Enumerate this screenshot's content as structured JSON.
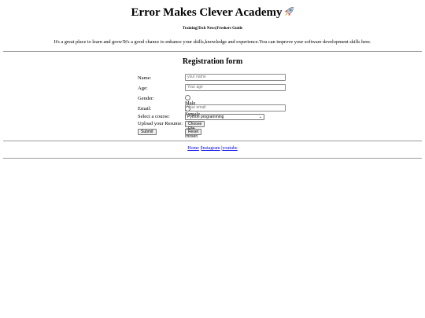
{
  "header": {
    "title": "Error Makes Clever Academy",
    "nav_text": "Training|Tech News|Freshers Guide",
    "intro": "It's a great place to learn and grow!It's a good chance to enhance your skills,knowledge and experience.You can improve your software development skills here."
  },
  "form": {
    "heading": "Registration form",
    "name_label": "Name:",
    "name_placeholder": "your name",
    "age_label": "Age:",
    "age_placeholder": "Your age",
    "gender_label": "Gender:",
    "gender_male": "Male",
    "gender_female": "Female",
    "email_label": "Email:",
    "email_placeholder": "Your email",
    "course_label": "Select a course:",
    "course_selected": "Python programming",
    "resume_label": "Upload your Resume:",
    "choose_file": "Choose File",
    "no_file": "No file chosen",
    "submit": "Submit",
    "reset": "Reset"
  },
  "footer": {
    "home": "Home",
    "instagram": "Instagram",
    "youtube": "youtube"
  }
}
